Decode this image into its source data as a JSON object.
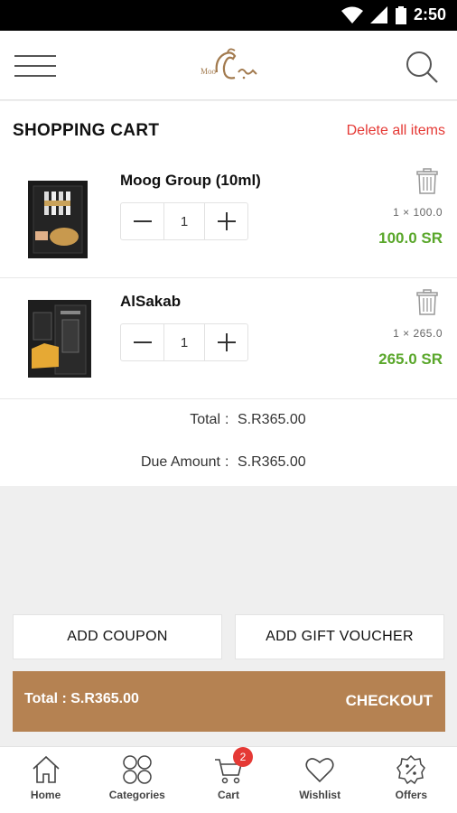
{
  "status_bar": {
    "time": "2:50"
  },
  "header": {
    "logo_text": "Moo"
  },
  "cart": {
    "title": "SHOPPING CART",
    "delete_all_label": "Delete all items",
    "items": [
      {
        "name": "Moog Group (10ml)",
        "quantity": "1",
        "unit_line": "1 × 100.0",
        "line_total": "100.0 SR"
      },
      {
        "name": "AlSakab",
        "quantity": "1",
        "unit_line": "1 × 265.0",
        "line_total": "265.0 SR"
      }
    ]
  },
  "summary": {
    "total_label": "Total",
    "total_value": "S.R365.00",
    "due_label": "Due Amount",
    "due_value": "S.R365.00"
  },
  "actions": {
    "coupon_label": "ADD COUPON",
    "voucher_label": "ADD GIFT VOUCHER"
  },
  "checkout": {
    "total_text": "Total : S.R365.00",
    "button_label": "CHECKOUT"
  },
  "bottom_nav": {
    "items": [
      {
        "label": "Home",
        "icon": "home-icon"
      },
      {
        "label": "Categories",
        "icon": "categories-icon"
      },
      {
        "label": "Cart",
        "icon": "cart-icon",
        "badge": "2"
      },
      {
        "label": "Wishlist",
        "icon": "heart-icon"
      },
      {
        "label": "Offers",
        "icon": "offers-icon"
      }
    ]
  },
  "colors": {
    "accent": "#b58252",
    "delete": "#e53935",
    "price": "#5aa72b",
    "badge": "#e53935"
  }
}
